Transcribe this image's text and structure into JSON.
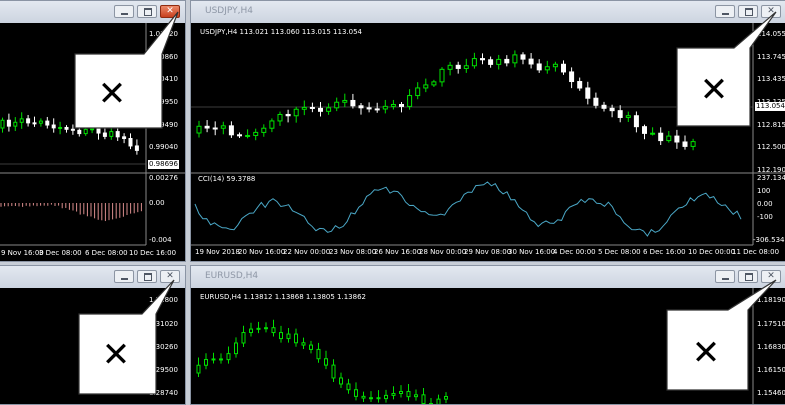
{
  "top_left": {
    "buttons": {
      "close": "✕"
    },
    "price_scale": [
      "1.01320",
      "1.00860",
      "1.00410",
      "0.99950",
      "0.99490",
      "0.99040"
    ],
    "current_price": "0.98696",
    "cci_scale": [
      "0.00276",
      "0.00",
      "-0.004"
    ],
    "dates": [
      "9 Nov 16:00",
      "3 Dec 08:00",
      "6 Dec 08:00",
      "10 Dec 16:00"
    ]
  },
  "usdjpy": {
    "title": "USDJPY,H4",
    "info": "USDJPY,H4  113.021 113.060 113.015 113.054",
    "price_scale": [
      "114.055",
      "113.745",
      "113.435",
      "113.125",
      "112.815",
      "112.500",
      "112.190"
    ],
    "current_price": "113.054",
    "cci_label": "CCI(14) 59.3788",
    "cci_scale": [
      "237.134",
      "100",
      "0.00",
      "-100",
      "-306.5346"
    ],
    "dates": [
      "19 Nov 2018",
      "20 Nov 16:00",
      "22 Nov 00:00",
      "23 Nov 08:00",
      "26 Nov 16:00",
      "28 Nov 00:00",
      "29 Nov 08:00",
      "30 Nov 16:00",
      "4 Dec 00:00",
      "5 Dec 08:00",
      "6 Dec 16:00",
      "10 Dec 00:00",
      "11 Dec 08:00"
    ]
  },
  "bottom_left": {
    "price_scale": [
      "1.31800",
      "1.31020",
      "1.30260",
      "1.29500",
      "1.28740"
    ]
  },
  "eurusd": {
    "title": "EURUSD,H4",
    "info": "EURUSD,H4  1.13812 1.13868 1.13805 1.13862",
    "price_scale": [
      "1.18190",
      "1.17510",
      "1.16830",
      "1.16150",
      "1.15460"
    ]
  },
  "callout_glyph": "✕",
  "colors": {
    "bull": "#00e000",
    "bear": "#ffffff",
    "cci_line": "#4aa7c6",
    "close_red": "#d0502a"
  }
}
